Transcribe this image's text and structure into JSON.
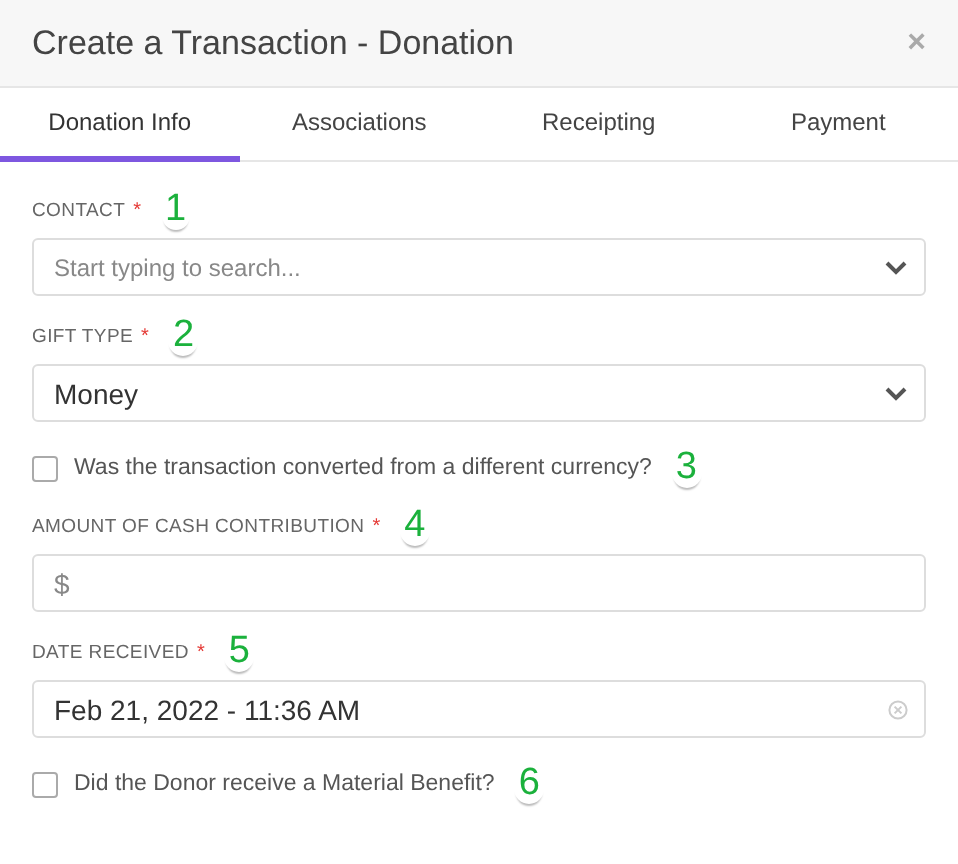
{
  "dialog": {
    "title": "Create a Transaction - Donation",
    "close": "×"
  },
  "tabs": [
    {
      "label": "Donation Info",
      "selected": true
    },
    {
      "label": "Associations",
      "selected": false
    },
    {
      "label": "Receipting",
      "selected": false
    },
    {
      "label": "Payment",
      "selected": false
    }
  ],
  "fields": [
    {
      "kind": "select",
      "label": "CONTACT",
      "required_mark": "*",
      "placeholder": "Start typing to search...",
      "callout": "1"
    },
    {
      "kind": "select",
      "label": "GIFT TYPE",
      "required_mark": "*",
      "value": "Money",
      "callout": "2"
    },
    {
      "kind": "checkbox",
      "label": "Was the transaction converted from a different currency?",
      "checked": false,
      "callout": "3"
    },
    {
      "kind": "text",
      "label": "AMOUNT OF CASH CONTRIBUTION",
      "required_mark": "*",
      "prefix": "$",
      "callout": "4"
    },
    {
      "kind": "date",
      "label": "DATE RECEIVED",
      "required_mark": "*",
      "value": "Feb 21, 2022 - 11:36 AM",
      "callout": "5"
    },
    {
      "kind": "checkbox",
      "label": "Did the Donor receive a Material Benefit?",
      "checked": false,
      "callout": "6"
    }
  ]
}
